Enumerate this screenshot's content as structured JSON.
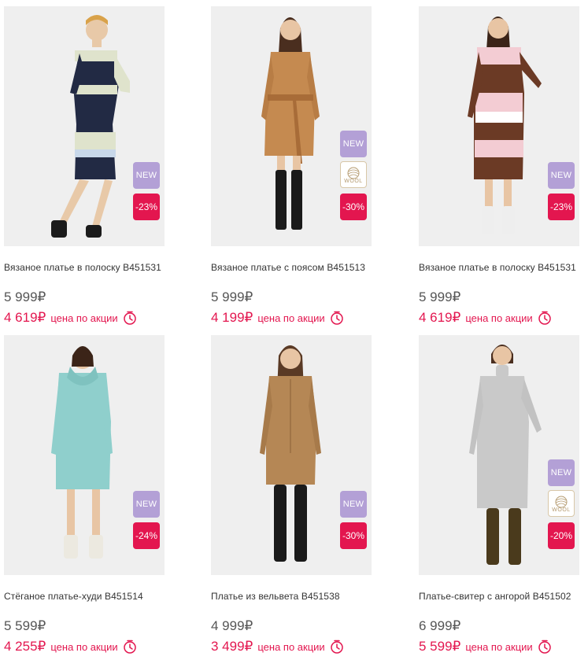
{
  "colors": {
    "accent": "#e3164f",
    "new_badge": "#b3a0d6",
    "text": "#333333",
    "photo_bg": "#efefef"
  },
  "products": [
    {
      "title": "Вязаное платье в полоску B451531",
      "price_old": "5 999₽",
      "price_new": "4 619₽",
      "promo_label": "цена по акции",
      "badge_new": "NEW",
      "badge_discount": "-23%",
      "badge_wool": ""
    },
    {
      "title": "Вязаное платье с поясом B451513",
      "price_old": "5 999₽",
      "price_new": "4 199₽",
      "promo_label": "цена по акции",
      "badge_new": "NEW",
      "badge_discount": "-30%",
      "badge_wool": "WOOL"
    },
    {
      "title": "Вязаное платье в полоску B451531",
      "price_old": "5 999₽",
      "price_new": "4 619₽",
      "promo_label": "цена по акции",
      "badge_new": "NEW",
      "badge_discount": "-23%",
      "badge_wool": ""
    },
    {
      "title": "Стёганое платье-худи B451514",
      "price_old": "5 599₽",
      "price_new": "4 255₽",
      "promo_label": "цена по акции",
      "badge_new": "NEW",
      "badge_discount": "-24%",
      "badge_wool": ""
    },
    {
      "title": "Платье из вельвета B451538",
      "price_old": "4 999₽",
      "price_new": "3 499₽",
      "promo_label": "цена по акции",
      "badge_new": "NEW",
      "badge_discount": "-30%",
      "badge_wool": ""
    },
    {
      "title": "Платье-свитер с ангорой B451502",
      "price_old": "6 999₽",
      "price_new": "5 599₽",
      "promo_label": "цена по акции",
      "badge_new": "NEW",
      "badge_discount": "-20%",
      "badge_wool": "WOOL"
    }
  ]
}
